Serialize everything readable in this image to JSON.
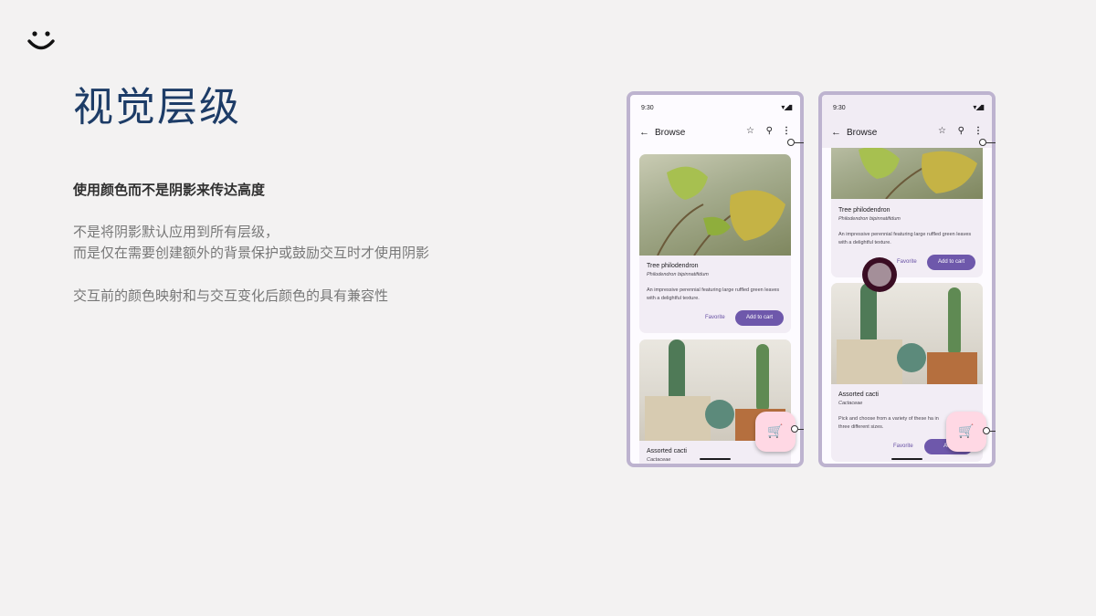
{
  "page": {
    "title": "视觉层级",
    "subtitle": "使用颜色而不是阴影来传达高度",
    "paragraph1_line1": "不是将阴影默认应用到所有层级，",
    "paragraph1_line2": "而是仅在需要创建额外的背景保护或鼓励交互时才使用阴影",
    "paragraph2": "交互前的颜色映射和与交互变化后颜色的具有兼容性"
  },
  "phone": {
    "time": "9:30",
    "status_icons": "▾◢▮",
    "back_icon": "←",
    "screen_title": "Browse",
    "star_icon": "☆",
    "search_icon": "⚲",
    "more_icon": "⋮",
    "cart_icon": "🛒"
  },
  "cards": [
    {
      "title": "Tree philodendron",
      "subtitle": "Philodendron bipinnatifidum",
      "description": "An impressive perennial featuring large ruffled green leaves with a delightful texture.",
      "favorite": "Favorite",
      "add_to_cart": "Add to cart"
    },
    {
      "title": "Assorted cacti",
      "subtitle": "Cactaceae",
      "description": "Pick and choose from a variety of these ha in three different sizes.",
      "favorite": "Favorite",
      "add_to_cart": "Add"
    }
  ],
  "colors": {
    "title": "#1d3c67",
    "phone_frame": "#bdb3cf",
    "primary": "#6e58ab",
    "fab": "#ffd8e4",
    "elevated_appbar": "#f1ecf4"
  }
}
